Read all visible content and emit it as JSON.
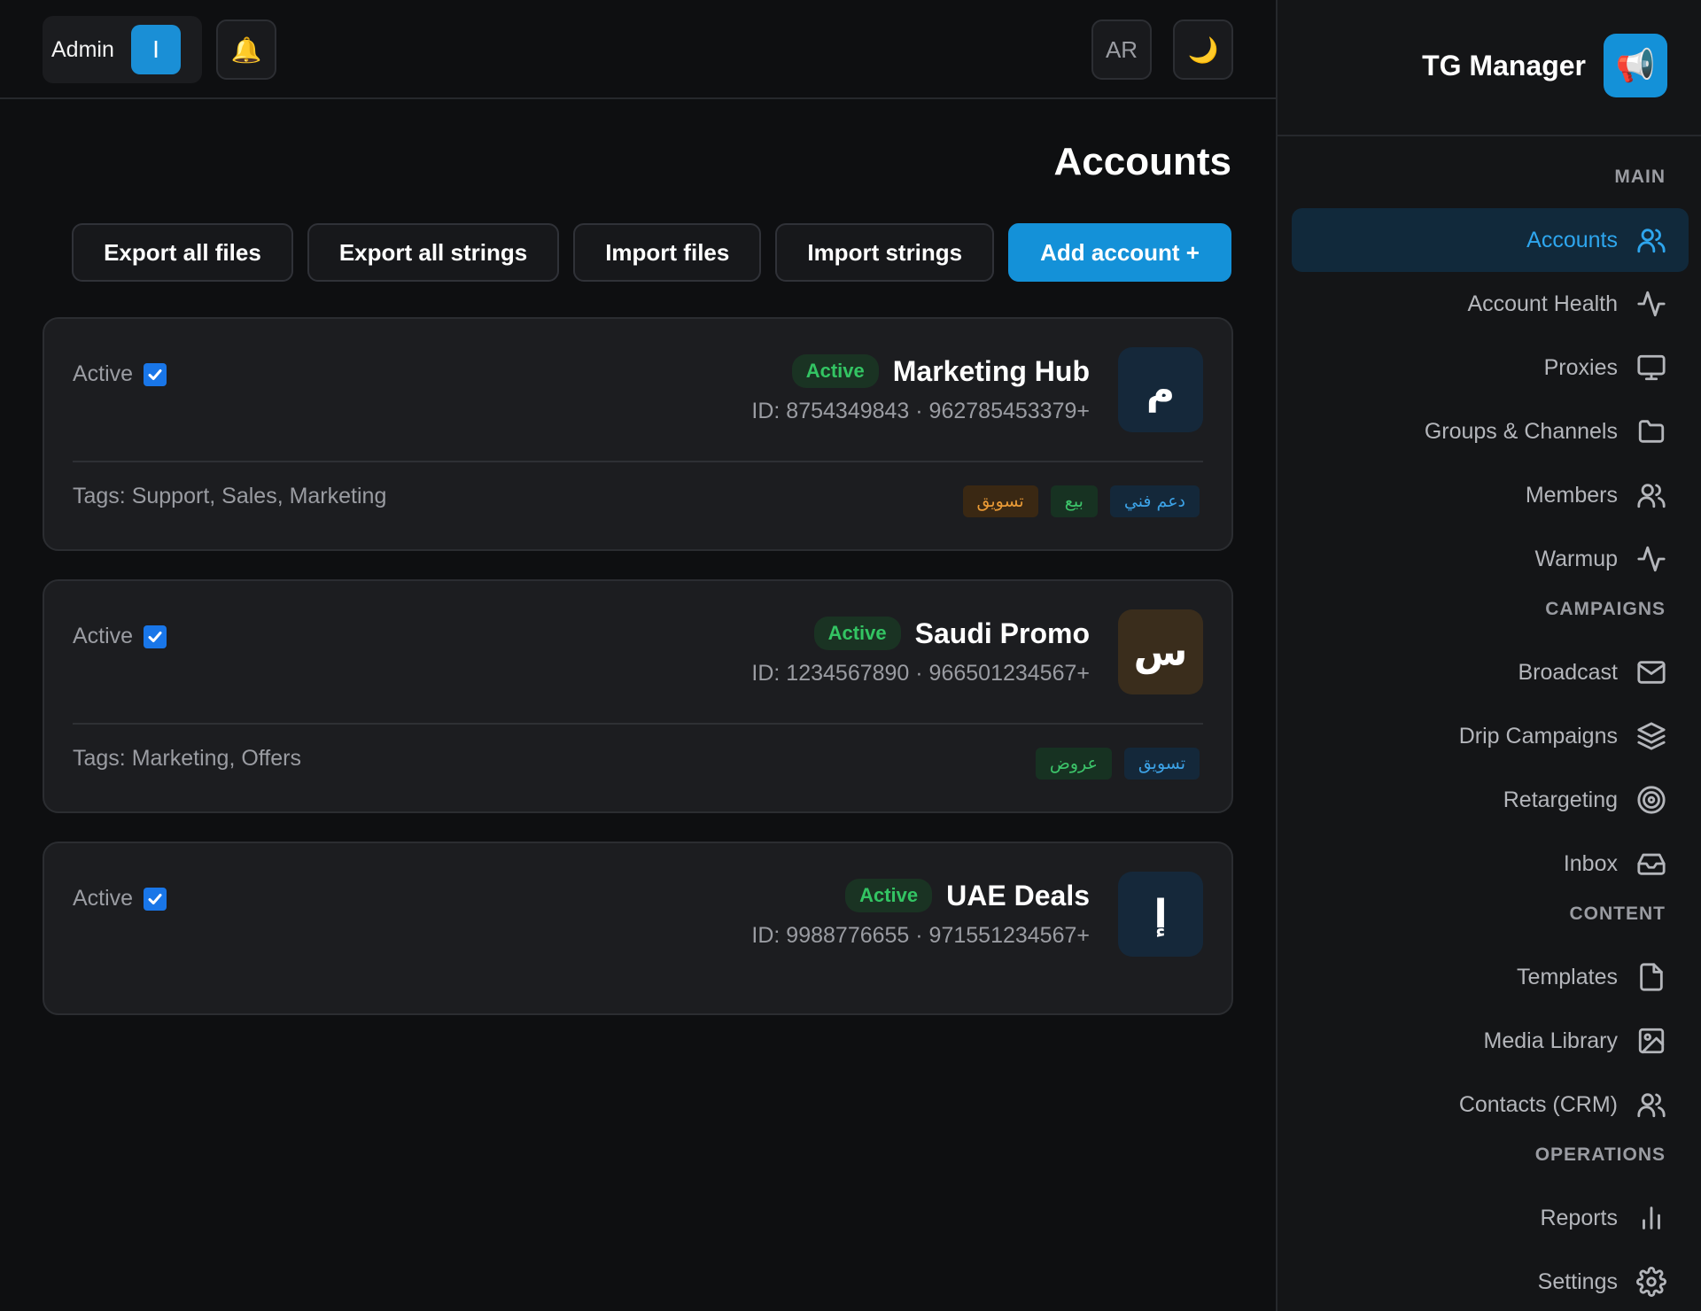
{
  "header": {
    "admin_label": "Admin",
    "admin_avatar": "I",
    "bell_icon": "🔔",
    "language": "AR",
    "theme_icon": "🌙"
  },
  "page": {
    "title": "Accounts"
  },
  "actions": {
    "add": "Add account +",
    "import_strings": "Import strings",
    "import_files": "Import files",
    "export_strings": "Export all strings",
    "export_files": "Export all files"
  },
  "accounts": [
    {
      "name": "Marketing Hub",
      "status": "Active",
      "meta": "ID: 8754349843 · 962785453379+",
      "avatar": "م",
      "avatar_color": "#15283a",
      "active_label": "Active",
      "tags_label": "Tags: Support, Sales, Marketing",
      "tags": [
        {
          "text": "دعم فني",
          "color": "blue"
        },
        {
          "text": "بيع",
          "color": "green"
        },
        {
          "text": "تسويق",
          "color": "orange"
        }
      ]
    },
    {
      "name": "Saudi Promo",
      "status": "Active",
      "meta": "ID: 1234567890 · 966501234567+",
      "avatar": "س",
      "avatar_color": "#3a2d1c",
      "active_label": "Active",
      "tags_label": "Tags: Marketing, Offers",
      "tags": [
        {
          "text": "تسويق",
          "color": "blue"
        },
        {
          "text": "عروض",
          "color": "green"
        }
      ]
    },
    {
      "name": "UAE Deals",
      "status": "Active",
      "meta": "ID: 9988776655 · 971551234567+",
      "avatar": "إ",
      "avatar_color": "#15283a",
      "active_label": "Active"
    }
  ],
  "sidebar": {
    "brand": "TG Manager",
    "brand_logo": "📢",
    "sections": {
      "main": "MAIN",
      "campaigns": "CAMPAIGNS",
      "content": "CONTENT",
      "operations": "OPERATIONS"
    },
    "items": {
      "accounts": "Accounts",
      "account_health": "Account Health",
      "proxies": "Proxies",
      "groups": "Groups & Channels",
      "members": "Members",
      "warmup": "Warmup",
      "broadcast": "Broadcast",
      "drip": "Drip Campaigns",
      "retargeting": "Retargeting",
      "inbox": "Inbox",
      "templates": "Templates",
      "media": "Media Library",
      "contacts": "Contacts (CRM)",
      "reports": "Reports",
      "settings": "Settings"
    }
  },
  "colors": {
    "accent": "#1491d8",
    "active_status": "#33c463"
  }
}
